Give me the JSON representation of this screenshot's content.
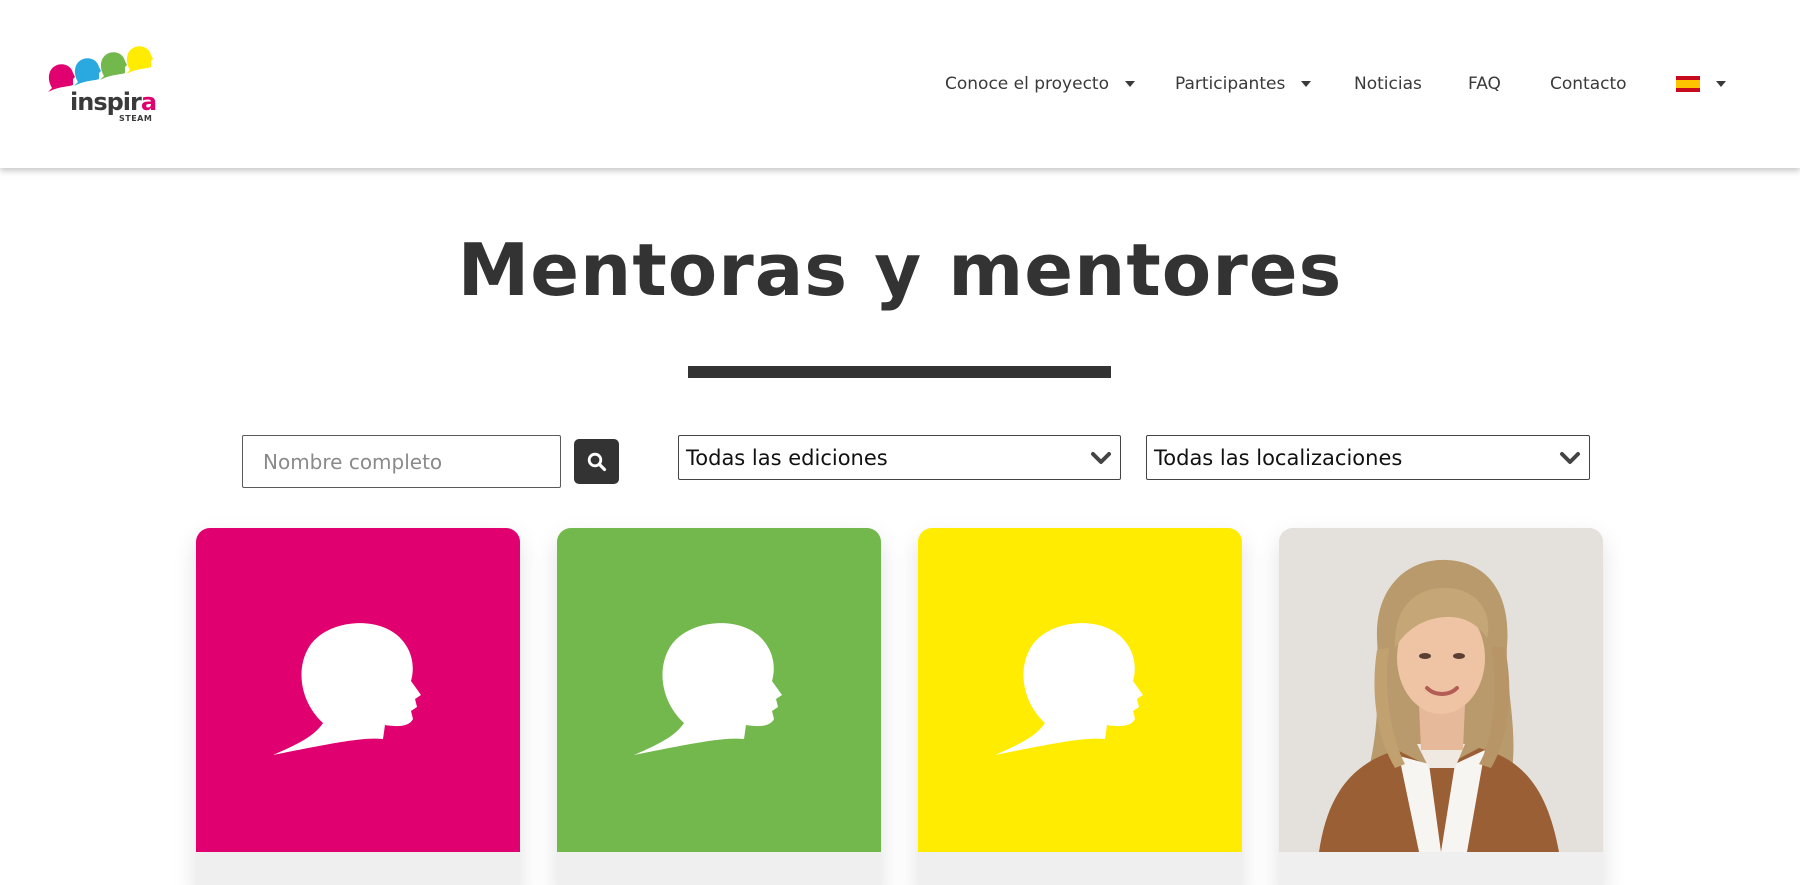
{
  "header": {
    "logo": {
      "word_main": "inspir",
      "word_accent": "a",
      "sub": "STEAM",
      "head_colors": [
        "#e0006f",
        "#2aa9e0",
        "#72b84c",
        "#ffec00"
      ]
    },
    "nav": [
      {
        "label": "Conoce el proyecto",
        "has_dropdown": true
      },
      {
        "label": "Participantes",
        "has_dropdown": true
      },
      {
        "label": "Noticias",
        "has_dropdown": false
      },
      {
        "label": "FAQ",
        "has_dropdown": false
      },
      {
        "label": "Contacto",
        "has_dropdown": false
      }
    ],
    "language": {
      "icon": "spain-flag-icon",
      "has_dropdown": true
    }
  },
  "main": {
    "title": "Mentoras y mentores",
    "filters": {
      "search_placeholder": "Nombre completo",
      "search_value": "",
      "search_icon": "search-icon",
      "edition_selected": "Todas las ediciones",
      "location_selected": "Todas las localizaciones",
      "dropdown_icon": "chevron-down-icon"
    },
    "cards": [
      {
        "type": "placeholder",
        "bg_color": "#e0006f",
        "icon": "head-silhouette-icon"
      },
      {
        "type": "placeholder",
        "bg_color": "#72b84c",
        "icon": "head-silhouette-icon"
      },
      {
        "type": "placeholder",
        "bg_color": "#ffec00",
        "icon": "head-silhouette-icon"
      },
      {
        "type": "photo",
        "icon": "mentor-portrait"
      }
    ]
  },
  "colors": {
    "dark": "#333333",
    "magenta": "#e0006f",
    "green": "#72b84c",
    "yellow": "#ffec00",
    "blue": "#2aa9e0"
  }
}
